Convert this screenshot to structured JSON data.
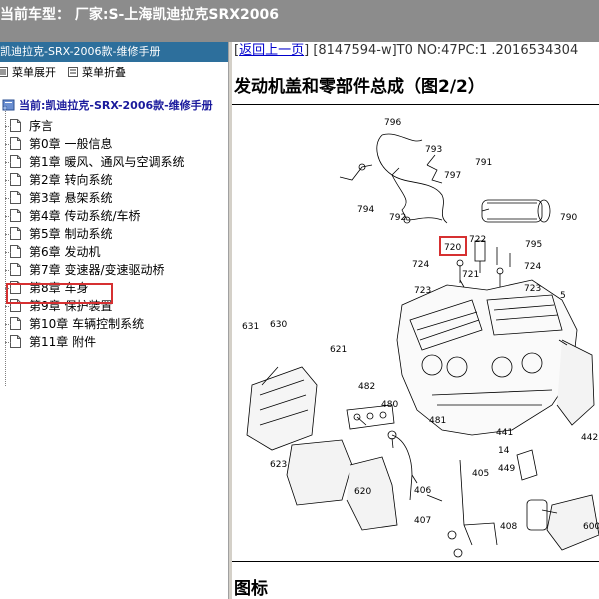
{
  "titlebar": {
    "text": "当前车型：  厂家:S-上海凯迪拉克SRX2006"
  },
  "sidebar": {
    "header": "凯迪拉克-SRX-2006款-维修手册",
    "toolbar": {
      "expand_label": "菜单展开",
      "collapse_label": "菜单折叠"
    },
    "root_label": "当前:凯迪拉克-SRX-2006款-维修手册",
    "items": [
      {
        "label": "序言"
      },
      {
        "label": "第0章 一般信息"
      },
      {
        "label": "第1章 暖风、通风与空调系统"
      },
      {
        "label": "第2章 转向系统"
      },
      {
        "label": "第3章 悬架系统"
      },
      {
        "label": "第4章 传动系统/车桥"
      },
      {
        "label": "第5章 制动系统"
      },
      {
        "label": "第6章 发动机",
        "selected": true
      },
      {
        "label": "第7章 变速器/变速驱动桥"
      },
      {
        "label": "第8章 车身"
      },
      {
        "label": "第9章 保护装置"
      },
      {
        "label": "第10章 车辆控制系统"
      },
      {
        "label": "第11章 附件"
      }
    ]
  },
  "content": {
    "back_link": "返回上一页",
    "doc_info": "[8147594-w]T0 NO:47PC:1 .2016534304",
    "title": "发动机盖和零部件总成（图2/2）",
    "figure": {
      "callouts": [
        "796",
        "793",
        "797",
        "791",
        "794",
        "792",
        "790",
        "795",
        "720",
        "722",
        "724",
        "724",
        "721",
        "723",
        "723",
        "5",
        "631",
        "630",
        "621",
        "482",
        "480",
        "481",
        "441",
        "442",
        "14",
        "449",
        "623",
        "620",
        "405",
        "406",
        "407",
        "408",
        "600"
      ],
      "highlighted_callout": "720"
    },
    "legend_title": "图标"
  },
  "colors": {
    "titlebar": "#8c8c8c",
    "sidebar_header": "#2d6f9c",
    "highlight": "#d63031",
    "link": "#0000cc"
  }
}
